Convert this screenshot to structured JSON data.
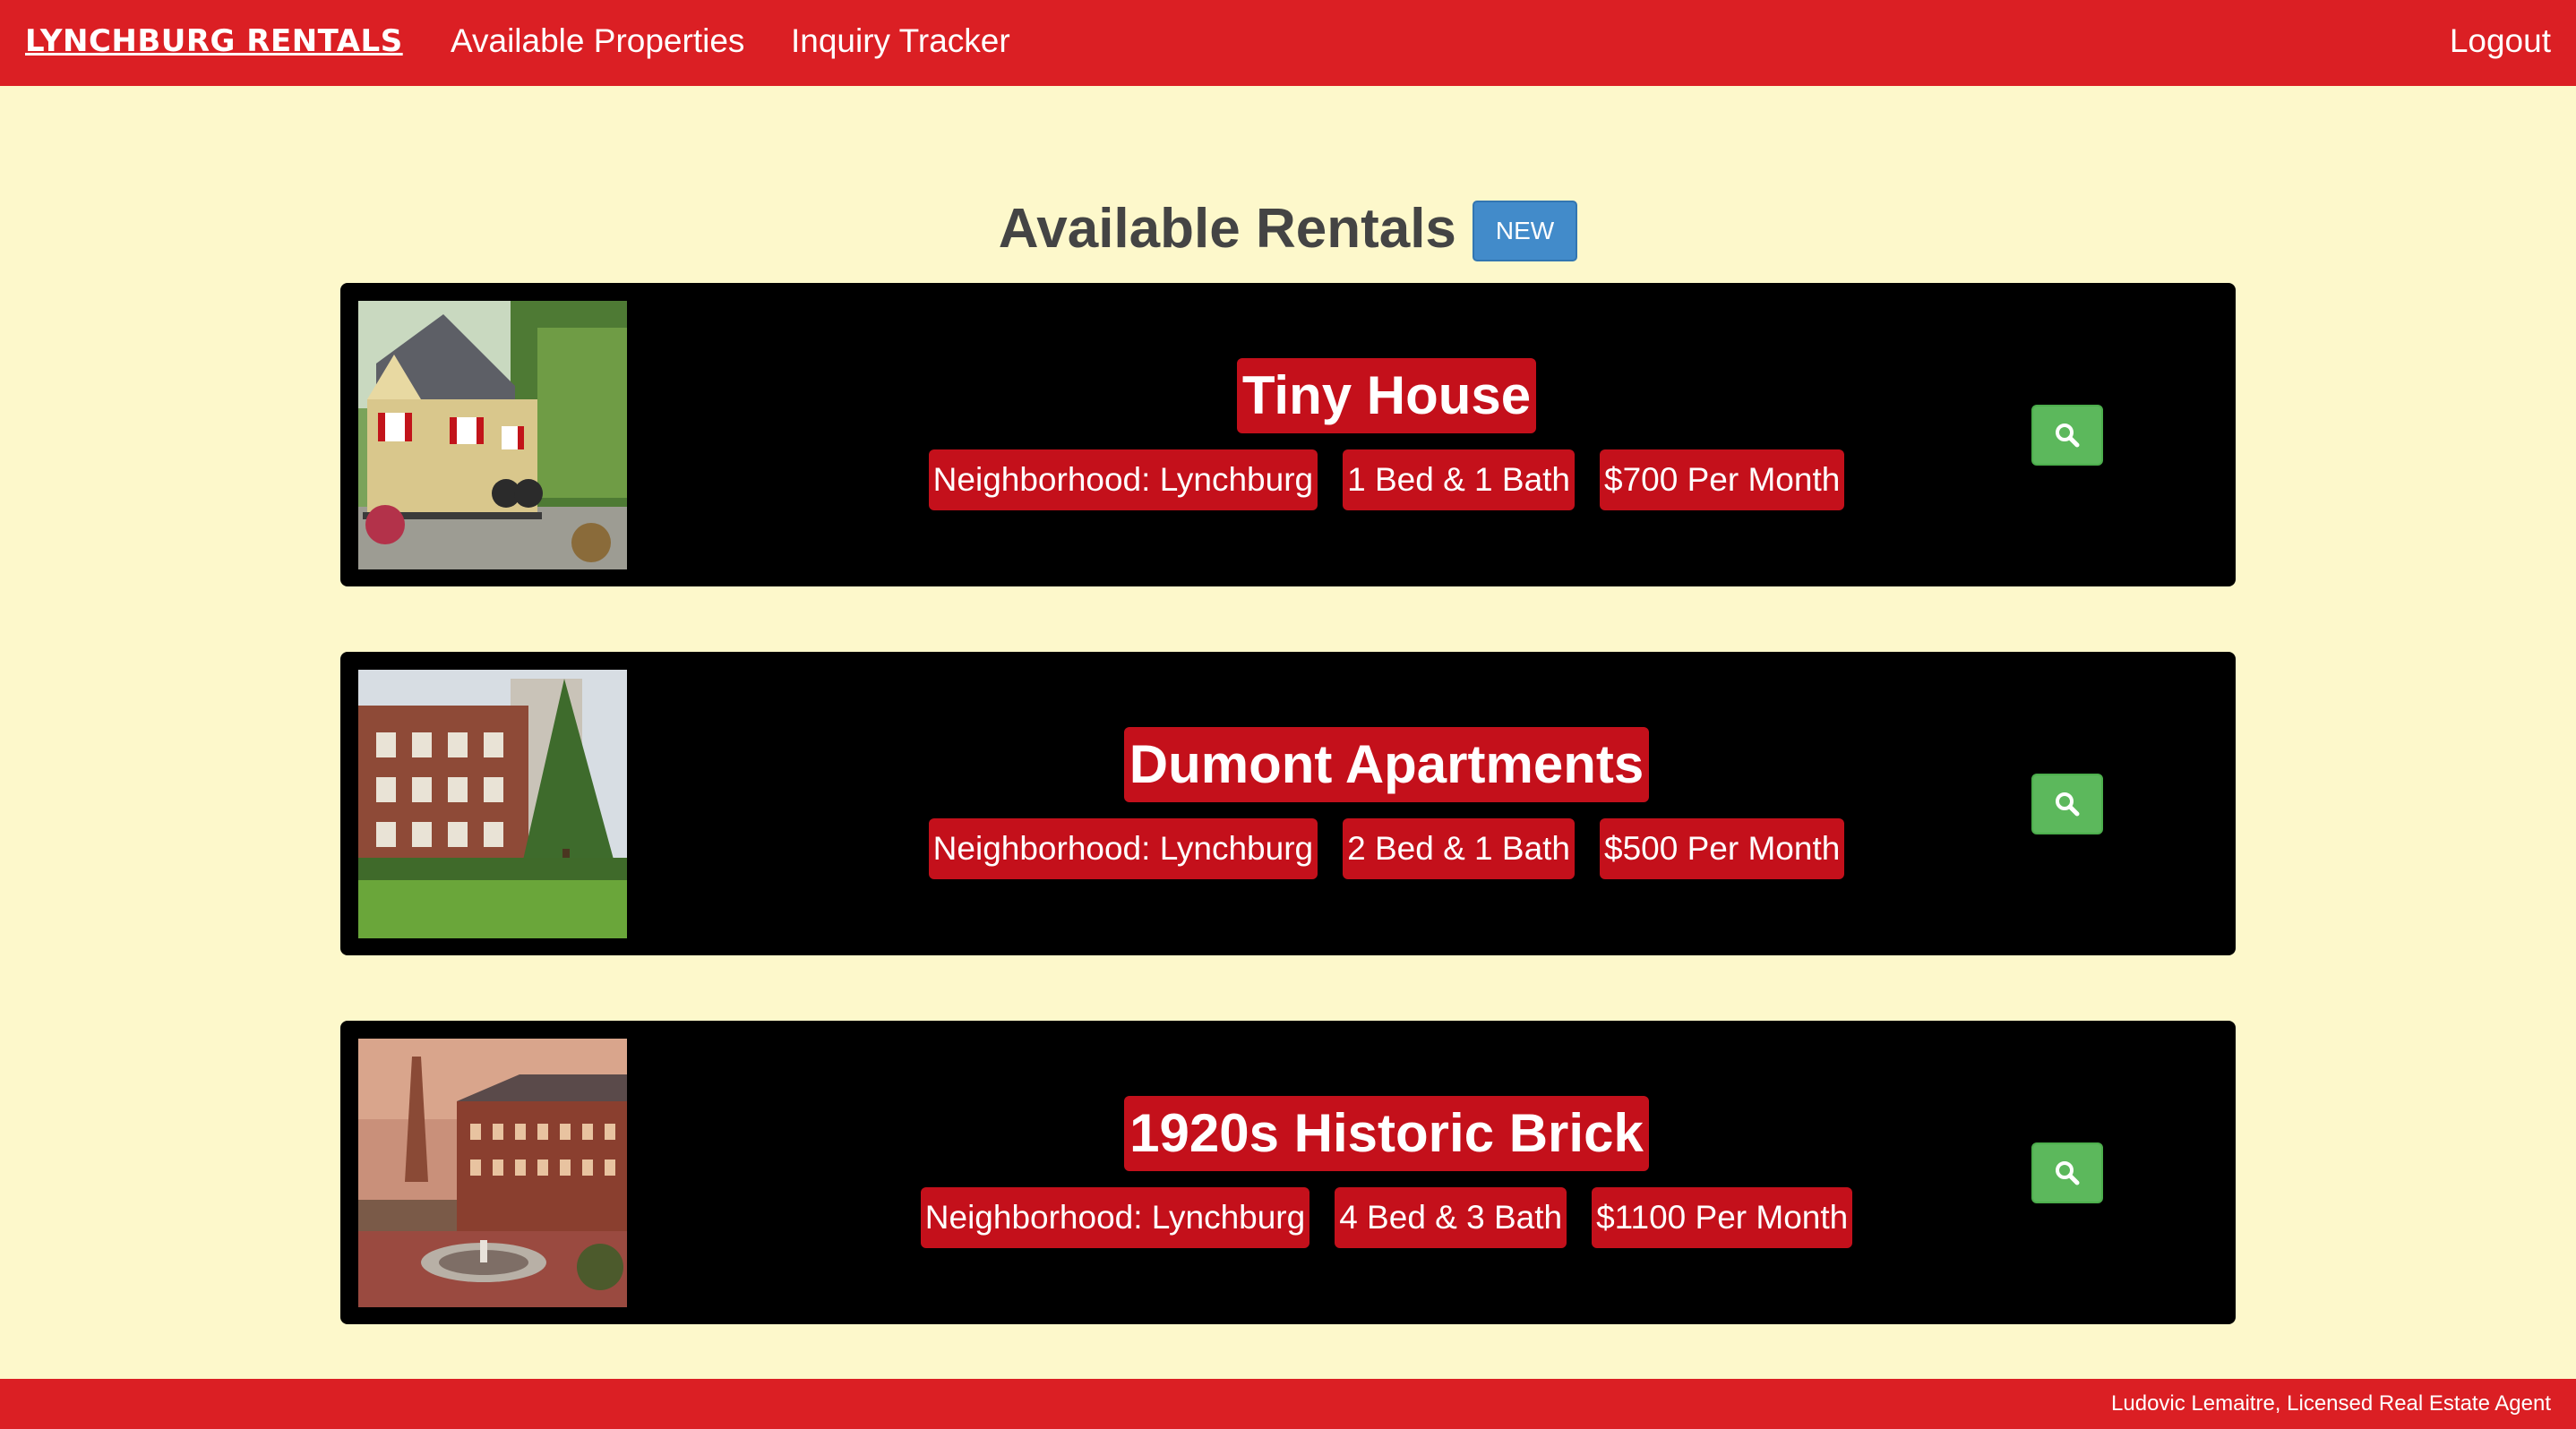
{
  "nav": {
    "brand": "LYNCHBURG RENTALS",
    "links": [
      "Available Properties",
      "Inquiry Tracker"
    ],
    "logout": "Logout"
  },
  "header": {
    "title": "Available Rentals",
    "new_button": "NEW"
  },
  "listings": [
    {
      "title": "Tiny House",
      "neighborhood": "Neighborhood: Lynchburg",
      "rooms": "1 Bed & 1 Bath",
      "price": "$700 Per Month",
      "photo": "tiny-house-photo",
      "action_icon": "search-icon"
    },
    {
      "title": "Dumont Apartments",
      "neighborhood": "Neighborhood: Lynchburg",
      "rooms": "2 Bed & 1 Bath",
      "price": "$500 Per Month",
      "photo": "apartment-building-photo",
      "action_icon": "search-icon"
    },
    {
      "title": "1920s Historic Brick",
      "neighborhood": "Neighborhood: Lynchburg",
      "rooms": "4 Bed & 3 Bath",
      "price": "$1100 Per Month",
      "photo": "historic-brick-building-photo",
      "action_icon": "search-icon"
    }
  ],
  "footer": {
    "credit": "Ludovic Lemaitre, Licensed Real Estate Agent"
  },
  "colors": {
    "nav_red": "#db1f24",
    "tag_red": "#c4101b",
    "background": "#fdf8cb",
    "new_blue": "#428bca",
    "search_green": "#5cb85c",
    "card_black": "#000000"
  }
}
